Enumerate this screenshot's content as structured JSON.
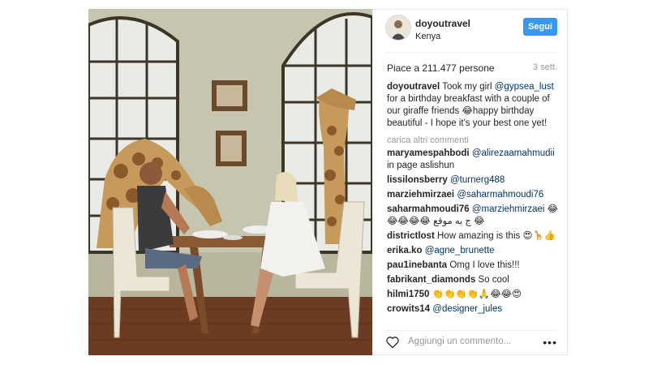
{
  "post": {
    "username": "doyoutravel",
    "location": "Kenya",
    "follow_label": "Segui",
    "likes_text": "Piace a 211.477 persone",
    "time_ago": "3 sett.",
    "caption": {
      "username": "doyoutravel",
      "text_before": "Took my girl",
      "mention": "@gypsea_lust",
      "text_after": "for a birthday breakfast with a couple of our giraffe friends 😂happy birthday beautiful - I hope it's your best one yet!"
    },
    "load_more_label": "carica altri commenti",
    "comments": [
      {
        "user": "maryamespahbodi",
        "mention": "@alirezaamahmudii",
        "text": "in page aslishun"
      },
      {
        "user": "lissilonsberry",
        "mention": "@turnerg488",
        "text": ""
      },
      {
        "user": "marziehmirzaei",
        "mention": "@saharmahmoudi76",
        "text": ""
      },
      {
        "user": "saharmahmoudi76",
        "mention": "@marziehmirzaei",
        "text": "😂😂😂😂😂 ج به موقع 😂"
      },
      {
        "user": "districtlost",
        "mention": "",
        "text": "How amazing is this 😍🦒👍"
      },
      {
        "user": "erika.ko",
        "mention": "@agne_brunette",
        "text": ""
      },
      {
        "user": "pau1inebanta",
        "mention": "",
        "text": "Omg I love this!!!"
      },
      {
        "user": "fabrikant_diamonds",
        "mention": "",
        "text": "So cool"
      },
      {
        "user": "hilmi1750",
        "mention": "",
        "text": "👏👏👏👏🙏😂😂😍"
      },
      {
        "user": "crowits14",
        "mention": "@designer_jules",
        "text": ""
      }
    ],
    "add_comment_placeholder": "Aggiungi un commento...",
    "more_options_label": "•••"
  },
  "colors": {
    "follow_button": "#3897f0",
    "mention": "#003569",
    "muted": "#999999"
  },
  "icons": {
    "like": "heart-icon",
    "more": "more-options-icon"
  }
}
